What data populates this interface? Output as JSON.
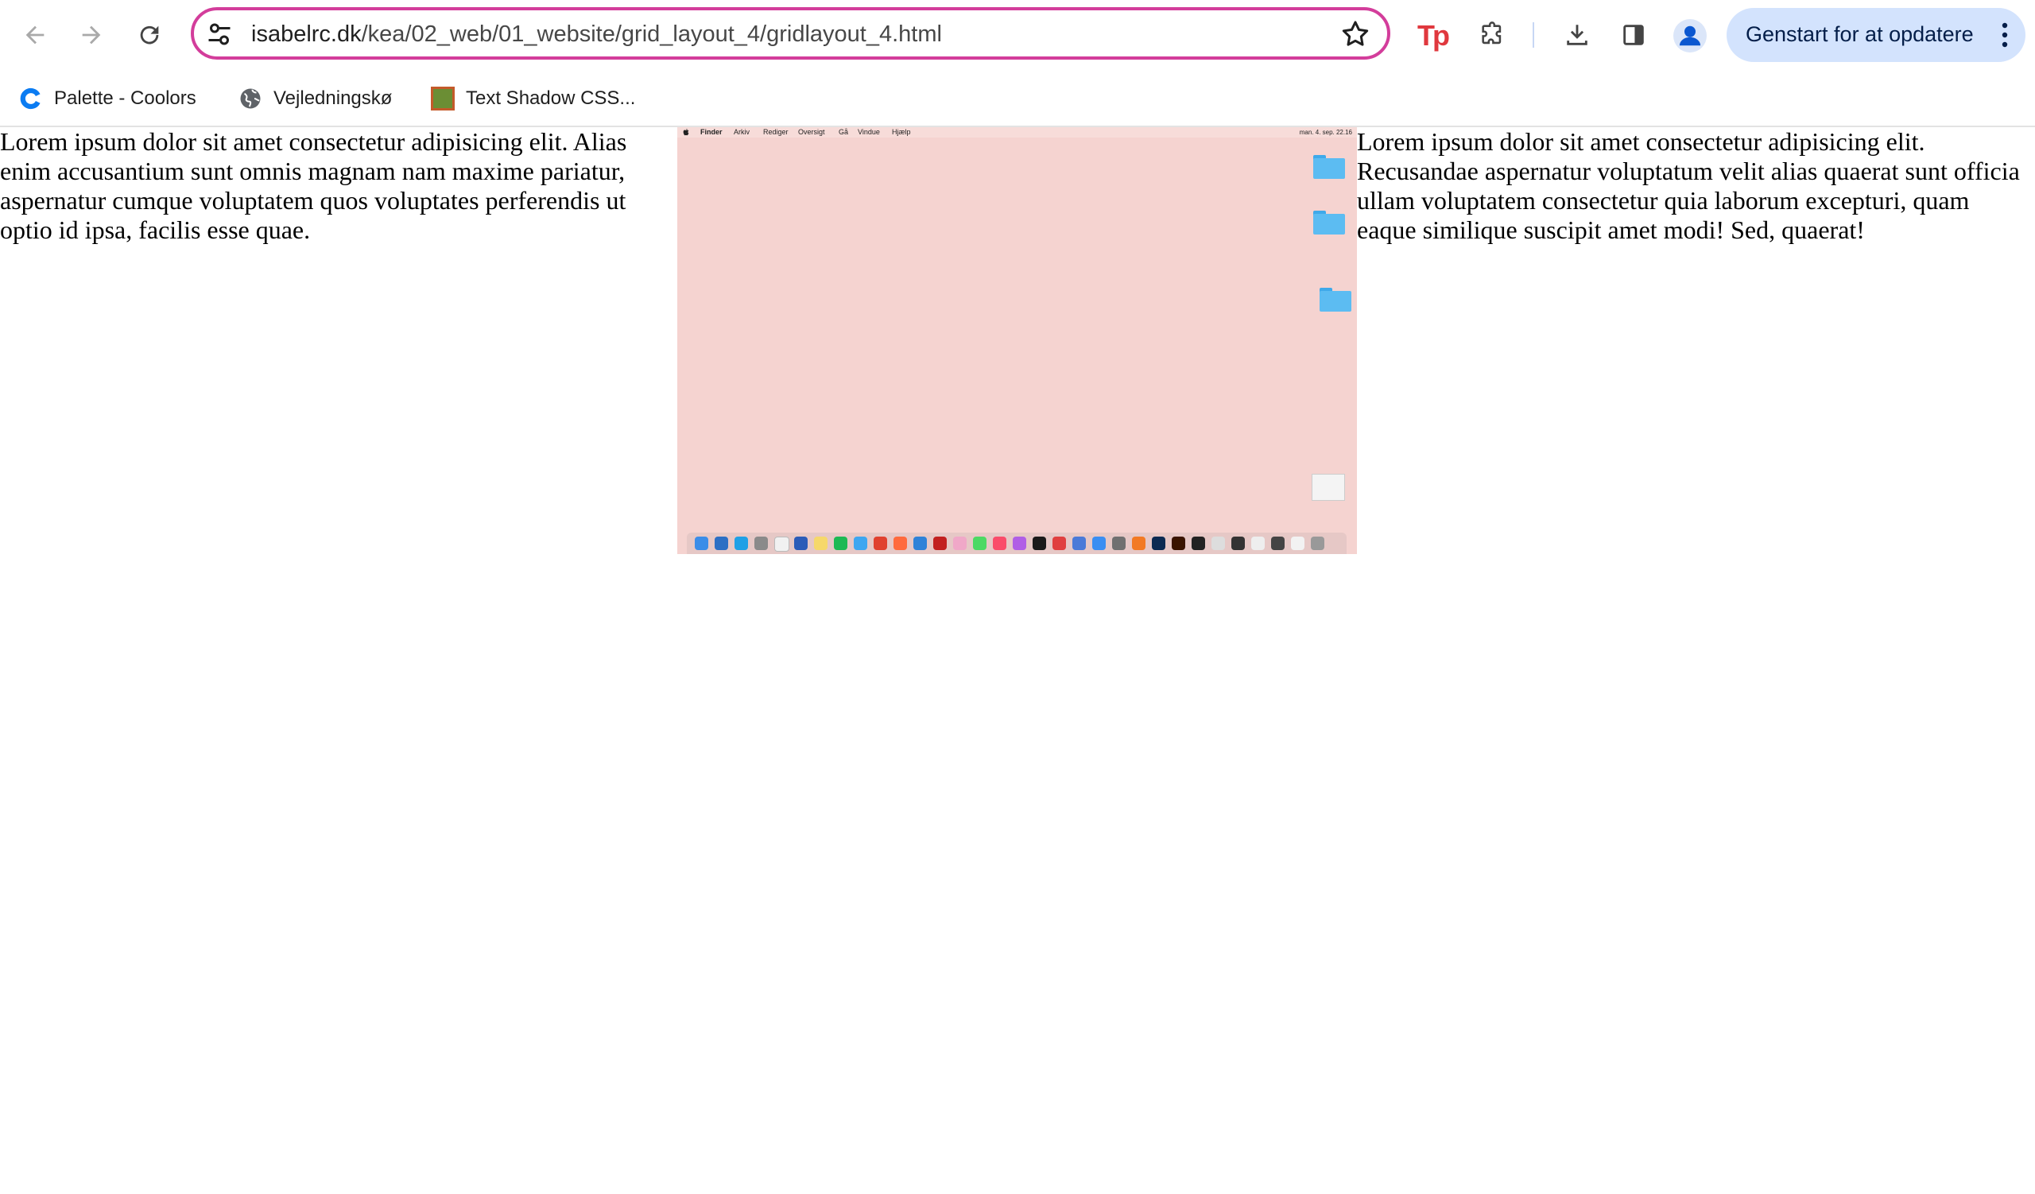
{
  "browser": {
    "url_host": "isabelrc.dk",
    "url_path": "/kea/02_web/01_website/grid_layout_4/gridlayout_4.html",
    "update_button_label": "Genstart for at opdatere",
    "extension_tp_label": "Tp",
    "icons": [
      "back-icon",
      "forward-icon",
      "reload-icon",
      "site-settings-icon",
      "star-icon",
      "extensions-icon",
      "download-icon",
      "side-panel-icon",
      "profile-icon",
      "more-icon"
    ],
    "accent_color": "#d33d9b"
  },
  "bookmarks": [
    {
      "label": "Palette - Coolors",
      "icon": "coolors-icon"
    },
    {
      "label": "Vejledningskø",
      "icon": "globe-icon"
    },
    {
      "label": "Text Shadow CSS...",
      "icon": "text-shadow-site-icon"
    }
  ],
  "page": {
    "left_text": "Lorem ipsum dolor sit amet consectetur adipisicing elit. Alias enim accusantium sunt omnis magnam nam maxime pariatur, aspernatur cumque voluptatem quos voluptates perferendis ut optio id ipsa, facilis esse quae.",
    "right_text": "Lorem ipsum dolor sit amet consectetur adipisicing elit. Recusandae aspernatur voluptatum velit alias quaerat sunt officia ullam voluptatem consectetur quia laborum excepturi, quam eaque similique suscipit amet modi! Sed, quaerat!"
  },
  "screenshot_image": {
    "menubar": [
      "Finder",
      "Arkiv",
      "Rediger",
      "Oversigt",
      "Gå",
      "Vindue",
      "Hjælp"
    ],
    "status_text": "man. 4. sep. 22.16",
    "background_color": "#f5d3d0"
  }
}
